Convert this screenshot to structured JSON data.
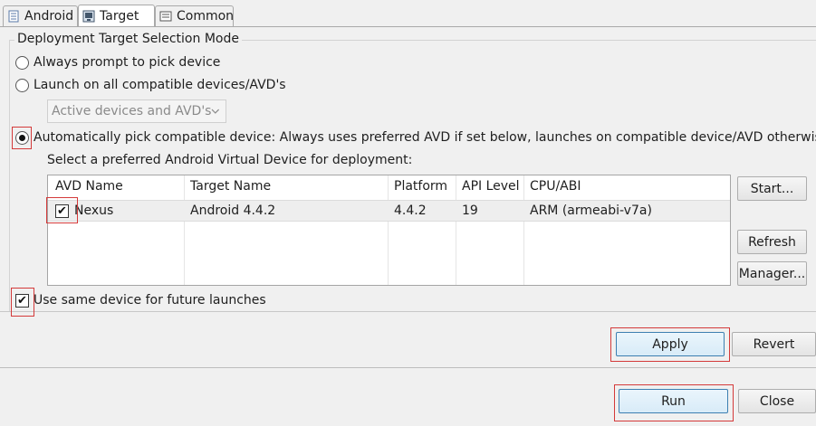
{
  "tabs": [
    {
      "label": "Android",
      "icon": "document-icon"
    },
    {
      "label": "Target",
      "icon": "device-icon"
    },
    {
      "label": "Common",
      "icon": "list-icon"
    }
  ],
  "group": {
    "legend": "Deployment Target Selection Mode",
    "options": [
      {
        "label": "Always prompt to pick device",
        "checked": false
      },
      {
        "label": "Launch on all compatible devices/AVD's",
        "checked": false
      },
      {
        "label": "Automatically pick compatible device: Always uses preferred AVD if set below, launches on compatible device/AVD otherwise.",
        "checked": true
      }
    ],
    "combo_value": "Active devices and AVD's",
    "avd_prompt": "Select a preferred Android Virtual Device for deployment:",
    "same_device_label": "Use same device for future launches"
  },
  "table": {
    "columns": [
      "AVD Name",
      "Target Name",
      "Platform",
      "API Level",
      "CPU/ABI"
    ],
    "rows": [
      {
        "name": "Nexus",
        "target": "Android 4.4.2",
        "platform": "4.4.2",
        "api": "19",
        "cpu": "ARM (armeabi-v7a)",
        "checked": true
      }
    ]
  },
  "side_buttons": {
    "start": "Start...",
    "refresh": "Refresh",
    "manager": "Manager..."
  },
  "footer": {
    "apply": "Apply",
    "revert": "Revert",
    "run": "Run",
    "close": "Close"
  },
  "colors": {
    "highlight": "#d43a3a",
    "accent": "#3c7fb1"
  }
}
